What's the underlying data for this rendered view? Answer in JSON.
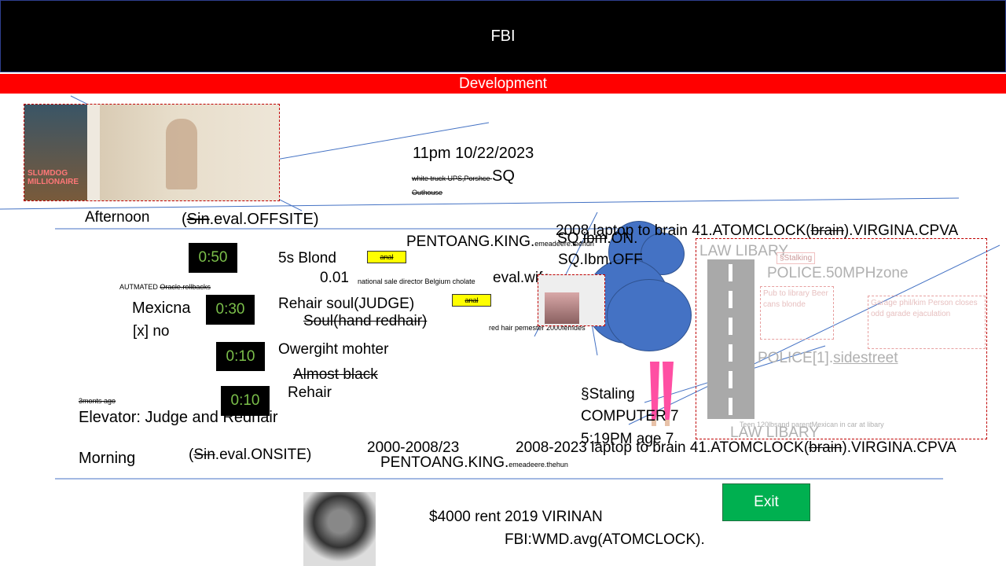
{
  "header": {
    "title": "FBI"
  },
  "banner": {
    "label": "Development"
  },
  "poster": {
    "title_line1": "SLUMDOG",
    "title_line2": "MILLIONAIRE"
  },
  "datetime": "11pm 10/22/2023",
  "sq_note": {
    "struck": "white truck UPS,Porshce ",
    "text": "SQ",
    "outhouse": "Outhouse"
  },
  "afternoon": {
    "label": "Afternoon",
    "eval_prefix": "(",
    "eval_struck": "Sin",
    "eval_rest": ".eval.OFFSITE)"
  },
  "timers": [
    "0:50",
    "0:30",
    "0:10",
    "0:10"
  ],
  "row1": {
    "text": "5s Blond",
    "tag": "anal"
  },
  "automated": {
    "text": "AUTMATED ",
    "struck": "Oracle.rollbacks"
  },
  "row_001": {
    "value": "0.01",
    "tiny": "national sale director Belgium cholate",
    "evalwife": "eval.wife"
  },
  "mexicna": "Mexicna",
  "xno": "[x] no",
  "rehair_soul": "Rehair  soul(JUDGE)",
  "tag2": "anal",
  "soul_struck": "Soul(hand redhair)",
  "redhair_tiny": "red hair pemester 2000femdes",
  "owergiht": "Owergiht mohter",
  "almost_black": "Almost black",
  "rehair": "Rehair",
  "months_ago": "3monts ago",
  "elevator": "Elevator: Judge and Redhair",
  "morning": {
    "label": "Morning",
    "eval_prefix": "(",
    "eval_struck": "Sin",
    "eval_rest": ".eval.ONSITE)"
  },
  "pentoang_top": {
    "text": "PENTOANG.KING.",
    "tiny": "emeadeere.thehun"
  },
  "sq_ibm_on": {
    "text": "SQ.",
    "struck": "ibm",
    "rest": ".ON."
  },
  "sq_ibm_off": "SQ.Ibm.OFF",
  "laptop_top": {
    "prefix": "2008 laptop to brain 41.ATOMCLOCK(",
    "struck": "brain",
    "suffix": ").VIRGINA.CPVA"
  },
  "law_library_top": "LAW LIBARY",
  "stalking_tag": "§Stalking",
  "police_speed": "POLICE.50MPHzone",
  "pub_box": "Pub to library Beer cans blonde",
  "garage_box": "Garage phil/kim Person closes odd garade ejaculation",
  "police_sidestreet": {
    "prefix": "POLICE[1].",
    "underlined": "sidestreet"
  },
  "law_small": "Teen 120lbsand parentMexican in car at libary",
  "law_library_bottom": "LAW LIBARY",
  "staling": "§Staling",
  "computer7": "COMPUTER 7",
  "time_age": "5:19PM age 7",
  "years_2000": "2000-2008/23",
  "pentoang_bottom": {
    "text": "PENTOANG.KING.",
    "tiny": "emeadeere.thehun"
  },
  "laptop_bottom": {
    "prefix": "2008-2023  laptop to brain 41.ATOMCLOCK(",
    "struck": "brain",
    "suffix": ").VIRGINA.CPVA"
  },
  "rent": "$4000 rent 2019 VIRINAN",
  "fbi_wmd": "FBI:WMD.avg(ATOMCLOCK).",
  "exit": {
    "label": "Exit"
  },
  "colors": {
    "header_bg": "#000000",
    "banner_bg": "#ff0000",
    "timer_bg": "#000000",
    "timer_text": "#7bbf4a",
    "exit_bg": "#00b050",
    "circle_blue": "#4472c4"
  }
}
